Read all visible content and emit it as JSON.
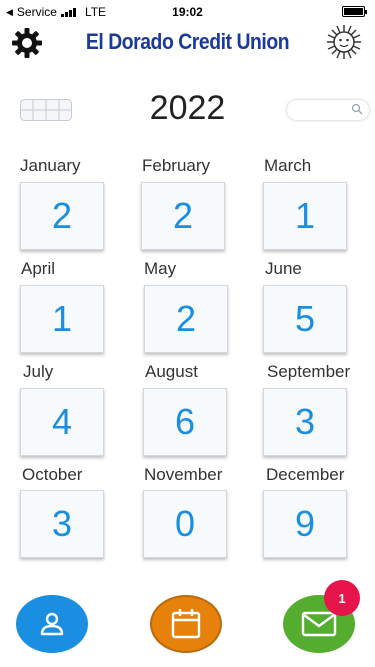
{
  "status_bar": {
    "carrier": "Service",
    "network": "LTE",
    "time": "19:02"
  },
  "header": {
    "title": "El Dorado Credit Union",
    "left_icon": "gear-icon",
    "right_icon": "sun-logo-icon"
  },
  "year": "2022",
  "search": {
    "placeholder": ""
  },
  "months": [
    {
      "name": "January",
      "count": "2"
    },
    {
      "name": "February",
      "count": "2"
    },
    {
      "name": "March",
      "count": "1"
    },
    {
      "name": "April",
      "count": "1"
    },
    {
      "name": "May",
      "count": "2"
    },
    {
      "name": "June",
      "count": "5"
    },
    {
      "name": "July",
      "count": "4"
    },
    {
      "name": "August",
      "count": "6"
    },
    {
      "name": "September",
      "count": "3"
    },
    {
      "name": "October",
      "count": "3"
    },
    {
      "name": "November",
      "count": "0"
    },
    {
      "name": "December",
      "count": "9"
    }
  ],
  "bottom_nav": {
    "profile_icon": "user-icon",
    "calendar_icon": "calendar-icon",
    "mail_icon": "mail-icon",
    "mail_badge": "1"
  },
  "colors": {
    "title": "#1b3a9c",
    "count": "#1a8ee0",
    "profile_button": "#1a8ee0",
    "calendar_button": "#e6810c",
    "mail_button": "#55ad2f",
    "badge": "#e5144b"
  }
}
